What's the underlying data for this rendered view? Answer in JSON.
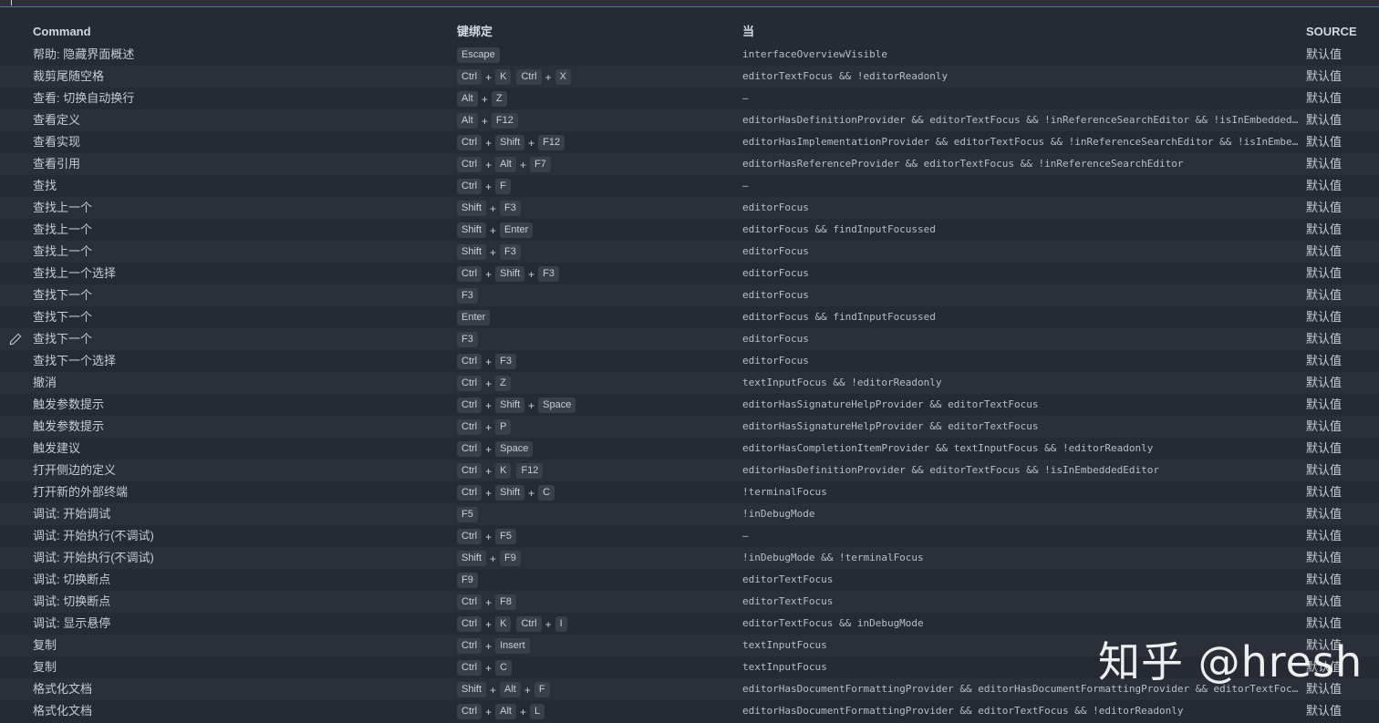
{
  "header": {
    "command": "Command",
    "keybinding": "键绑定",
    "when": "当",
    "source": "SOURCE"
  },
  "rows": [
    {
      "command": "帮助: 隐藏界面概述",
      "keys": [
        [
          "Escape"
        ]
      ],
      "when": "interfaceOverviewVisible",
      "source": "默认值"
    },
    {
      "command": "裁剪尾随空格",
      "keys": [
        [
          "Ctrl",
          "K"
        ],
        [
          "Ctrl",
          "X"
        ]
      ],
      "when": "editorTextFocus && !editorReadonly",
      "source": "默认值"
    },
    {
      "command": "查看: 切换自动换行",
      "keys": [
        [
          "Alt",
          "Z"
        ]
      ],
      "when": "—",
      "source": "默认值"
    },
    {
      "command": "查看定义",
      "keys": [
        [
          "Alt",
          "F12"
        ]
      ],
      "when": "editorHasDefinitionProvider && editorTextFocus && !inReferenceSearchEditor && !isInEmbeddedEditor",
      "source": "默认值"
    },
    {
      "command": "查看实现",
      "keys": [
        [
          "Ctrl",
          "Shift",
          "F12"
        ]
      ],
      "when": "editorHasImplementationProvider && editorTextFocus && !inReferenceSearchEditor && !isInEmbeddedEditor",
      "source": "默认值"
    },
    {
      "command": "查看引用",
      "keys": [
        [
          "Ctrl",
          "Alt",
          "F7"
        ]
      ],
      "when": "editorHasReferenceProvider && editorTextFocus && !inReferenceSearchEditor",
      "source": "默认值"
    },
    {
      "command": "查找",
      "keys": [
        [
          "Ctrl",
          "F"
        ]
      ],
      "when": "—",
      "source": "默认值"
    },
    {
      "command": "查找上一个",
      "keys": [
        [
          "Shift",
          "F3"
        ]
      ],
      "when": "editorFocus",
      "source": "默认值"
    },
    {
      "command": "查找上一个",
      "keys": [
        [
          "Shift",
          "Enter"
        ]
      ],
      "when": "editorFocus && findInputFocussed",
      "source": "默认值"
    },
    {
      "command": "查找上一个",
      "keys": [
        [
          "Shift",
          "F3"
        ]
      ],
      "when": "editorFocus",
      "source": "默认值"
    },
    {
      "command": "查找上一个选择",
      "keys": [
        [
          "Ctrl",
          "Shift",
          "F3"
        ]
      ],
      "when": "editorFocus",
      "source": "默认值"
    },
    {
      "command": "查找下一个",
      "keys": [
        [
          "F3"
        ]
      ],
      "when": "editorFocus",
      "source": "默认值"
    },
    {
      "command": "查找下一个",
      "keys": [
        [
          "Enter"
        ]
      ],
      "when": "editorFocus && findInputFocussed",
      "source": "默认值"
    },
    {
      "command": "查找下一个",
      "keys": [
        [
          "F3"
        ]
      ],
      "when": "editorFocus",
      "source": "默认值",
      "editing": true
    },
    {
      "command": "查找下一个选择",
      "keys": [
        [
          "Ctrl",
          "F3"
        ]
      ],
      "when": "editorFocus",
      "source": "默认值"
    },
    {
      "command": "撤消",
      "keys": [
        [
          "Ctrl",
          "Z"
        ]
      ],
      "when": "textInputFocus && !editorReadonly",
      "source": "默认值"
    },
    {
      "command": "触发参数提示",
      "keys": [
        [
          "Ctrl",
          "Shift",
          "Space"
        ]
      ],
      "when": "editorHasSignatureHelpProvider && editorTextFocus",
      "source": "默认值"
    },
    {
      "command": "触发参数提示",
      "keys": [
        [
          "Ctrl",
          "P"
        ]
      ],
      "when": "editorHasSignatureHelpProvider && editorTextFocus",
      "source": "默认值"
    },
    {
      "command": "触发建议",
      "keys": [
        [
          "Ctrl",
          "Space"
        ]
      ],
      "when": "editorHasCompletionItemProvider && textInputFocus && !editorReadonly",
      "source": "默认值"
    },
    {
      "command": "打开侧边的定义",
      "keys": [
        [
          "Ctrl",
          "K"
        ],
        [
          "F12"
        ]
      ],
      "when": "editorHasDefinitionProvider && editorTextFocus && !isInEmbeddedEditor",
      "source": "默认值"
    },
    {
      "command": "打开新的外部终端",
      "keys": [
        [
          "Ctrl",
          "Shift",
          "C"
        ]
      ],
      "when": "!terminalFocus",
      "source": "默认值"
    },
    {
      "command": "调试: 开始调试",
      "keys": [
        [
          "F5"
        ]
      ],
      "when": "!inDebugMode",
      "source": "默认值"
    },
    {
      "command": "调试: 开始执行(不调试)",
      "keys": [
        [
          "Ctrl",
          "F5"
        ]
      ],
      "when": "—",
      "source": "默认值"
    },
    {
      "command": "调试: 开始执行(不调试)",
      "keys": [
        [
          "Shift",
          "F9"
        ]
      ],
      "when": "!inDebugMode && !terminalFocus",
      "source": "默认值"
    },
    {
      "command": "调试: 切换断点",
      "keys": [
        [
          "F9"
        ]
      ],
      "when": "editorTextFocus",
      "source": "默认值"
    },
    {
      "command": "调试: 切换断点",
      "keys": [
        [
          "Ctrl",
          "F8"
        ]
      ],
      "when": "editorTextFocus",
      "source": "默认值"
    },
    {
      "command": "调试: 显示悬停",
      "keys": [
        [
          "Ctrl",
          "K"
        ],
        [
          "Ctrl",
          "I"
        ]
      ],
      "when": "editorTextFocus && inDebugMode",
      "source": "默认值"
    },
    {
      "command": "复制",
      "keys": [
        [
          "Ctrl",
          "Insert"
        ]
      ],
      "when": "textInputFocus",
      "source": "默认值"
    },
    {
      "command": "复制",
      "keys": [
        [
          "Ctrl",
          "C"
        ]
      ],
      "when": "textInputFocus",
      "source": "默认值"
    },
    {
      "command": "格式化文档",
      "keys": [
        [
          "Shift",
          "Alt",
          "F"
        ]
      ],
      "when": "editorHasDocumentFormattingProvider && editorHasDocumentFormattingProvider && editorTextFocus …",
      "source": "默认值"
    },
    {
      "command": "格式化文档",
      "keys": [
        [
          "Ctrl",
          "Alt",
          "L"
        ]
      ],
      "when": "editorHasDocumentFormattingProvider && editorTextFocus && !editorReadonly",
      "source": "默认值"
    }
  ],
  "watermark": "知乎 @hresh"
}
